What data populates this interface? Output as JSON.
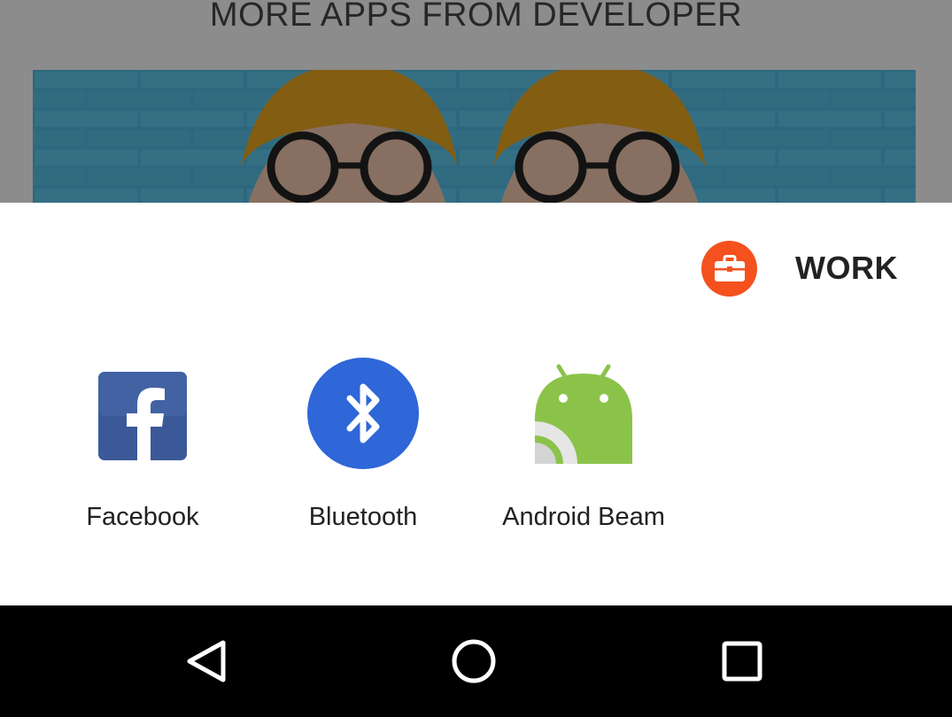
{
  "background_app": {
    "heading": "MORE APPS FROM DEVELOPER"
  },
  "share_sheet": {
    "profile_tab": {
      "label": "WORK",
      "icon": "briefcase-icon",
      "badge_color": "#f4511e"
    },
    "targets": [
      {
        "label": "Facebook",
        "icon": "facebook-icon",
        "color": "#3b5998"
      },
      {
        "label": "Bluetooth",
        "icon": "bluetooth-icon",
        "color": "#2f66d8"
      },
      {
        "label": "Android Beam",
        "icon": "android-beam-icon",
        "color": "#8bc34a"
      }
    ]
  },
  "navigation_bar": {
    "buttons": [
      "back",
      "home",
      "recents"
    ]
  }
}
